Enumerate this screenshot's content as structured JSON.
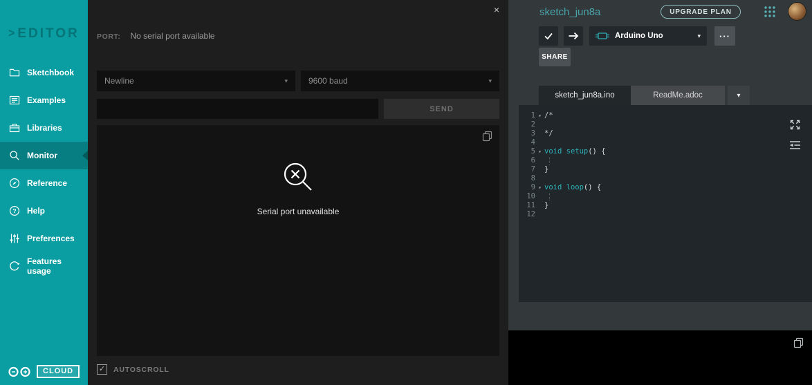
{
  "icons": {
    "caret_down": "▾",
    "more": "···",
    "close": "×",
    "check": "✓",
    "brand_chevron": ">",
    "question": "?"
  },
  "colors": {
    "accent_teal": "#0a9da1",
    "keyword_teal": "#2cb3b8",
    "sidebar_active": "#067e82"
  },
  "sidebar": {
    "brand": "EDITOR",
    "items": [
      {
        "label": "Sketchbook"
      },
      {
        "label": "Examples"
      },
      {
        "label": "Libraries"
      },
      {
        "label": "Monitor",
        "active": true
      },
      {
        "label": "Reference"
      },
      {
        "label": "Help"
      },
      {
        "label": "Preferences"
      },
      {
        "label": "Features usage"
      }
    ],
    "cloud_label": "CLOUD"
  },
  "monitor": {
    "port_label": "PORT:",
    "port_status": "No serial port available",
    "line_ending_selected": "Newline",
    "baud_rate_selected": "9600 baud",
    "send_label": "SEND",
    "input_value": "",
    "empty_state_text": "Serial port unavailable",
    "autoscroll_label": "AUTOSCROLL",
    "autoscroll_checked": true
  },
  "header": {
    "sketch_title": "sketch_jun8a",
    "upgrade_label": "UPGRADE PLAN"
  },
  "toolbar": {
    "board_name": "Arduino Uno",
    "share_label": "SHARE"
  },
  "tabs": [
    {
      "label": "sketch_jun8a.ino",
      "active": true
    },
    {
      "label": "ReadMe.adoc",
      "active": false
    }
  ],
  "editor": {
    "lines": [
      {
        "n": "1",
        "fold": true,
        "segs": [
          [
            "/*",
            "comment"
          ]
        ]
      },
      {
        "n": "2",
        "segs": []
      },
      {
        "n": "3",
        "segs": [
          [
            "*/",
            "comment"
          ]
        ]
      },
      {
        "n": "4",
        "segs": []
      },
      {
        "n": "5",
        "fold": true,
        "segs": [
          [
            "void",
            "kw"
          ],
          [
            " ",
            "plain"
          ],
          [
            "setup",
            "kw"
          ],
          [
            "() {",
            "plain"
          ]
        ]
      },
      {
        "n": "6",
        "guide": true,
        "segs": []
      },
      {
        "n": "7",
        "segs": [
          [
            "}",
            "plain"
          ]
        ]
      },
      {
        "n": "8",
        "segs": []
      },
      {
        "n": "9",
        "fold": true,
        "segs": [
          [
            "void",
            "kw"
          ],
          [
            " ",
            "plain"
          ],
          [
            "loop",
            "kw"
          ],
          [
            "() {",
            "plain"
          ]
        ]
      },
      {
        "n": "10",
        "guide": true,
        "segs": []
      },
      {
        "n": "11",
        "segs": [
          [
            "}",
            "plain"
          ]
        ]
      },
      {
        "n": "12",
        "segs": []
      }
    ]
  }
}
